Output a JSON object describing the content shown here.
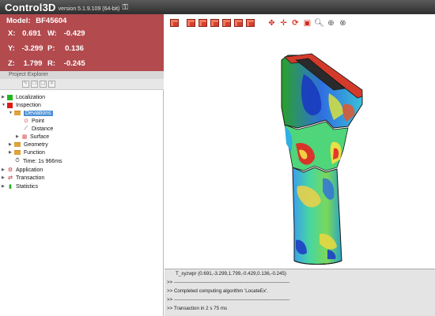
{
  "app": {
    "title": "Control3D",
    "version": "version 5.1.9.109 (64-bit)"
  },
  "coords": {
    "model_label": "Model:",
    "model_value": "BF45604",
    "x_label": "X:",
    "x_value": "0.691",
    "w_label": "W:",
    "w_value": "-0.429",
    "y_label": "Y:",
    "y_value": "-3.299",
    "p_label": "P:",
    "p_value": "0.136",
    "z_label": "Z:",
    "z_value": "1.799",
    "r_label": "R:",
    "r_value": "-0.245"
  },
  "project_explorer": {
    "title": "Project Explorer",
    "items": [
      {
        "label": "Localization",
        "icon": "green-square-icon"
      },
      {
        "label": "Inspection",
        "icon": "red-square-icon"
      },
      {
        "label": "Deviations",
        "icon": "folder-icon",
        "selected": true
      },
      {
        "label": "Point",
        "icon": "target-icon"
      },
      {
        "label": "Distance",
        "icon": "ruler-icon"
      },
      {
        "label": "Surface",
        "icon": "surface-icon"
      },
      {
        "label": "Geometry",
        "icon": "folder-icon"
      },
      {
        "label": "Function",
        "icon": "folder-icon"
      },
      {
        "label": "Time: 1s 966ms",
        "icon": "stopwatch-icon"
      },
      {
        "label": "Application",
        "icon": "application-icon"
      },
      {
        "label": "Transaction",
        "icon": "transaction-icon"
      },
      {
        "label": "Statistics",
        "icon": "bar-chart-icon"
      }
    ]
  },
  "console": {
    "lines": [
      "T_xyzwpr (0.691,-3.299,1.799,-0.429,0.136,-0.245)",
      ">> -----------------------------------------------------------------------",
      ">>            Completed computing algorithm 'LocateEx'.",
      ">> -----------------------------------------------------------------------",
      ">> Transaction in 2 s 75 ms"
    ]
  },
  "colors": {
    "titlebar": "#3a3a3a",
    "coord_panel": "#b24a4e",
    "selection": "#4a8fd6",
    "console_bg": "#e4e4e4"
  }
}
